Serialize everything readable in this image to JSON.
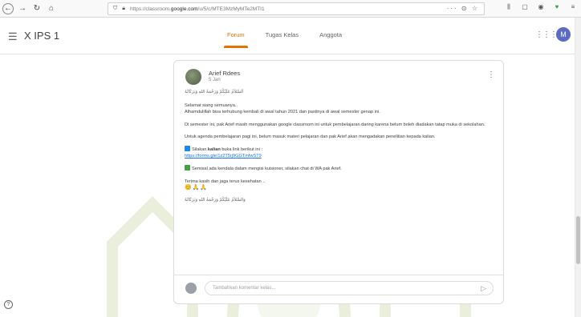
{
  "browser": {
    "url_prefix": "https://classroom.",
    "url_domain": "google.com",
    "url_path": "/u/5/c/MTE3MzMyMTe2MTI1",
    "url_actions": "··· ⊙ ☆"
  },
  "header": {
    "class_title": "X IPS 1",
    "tabs": [
      {
        "label": "Forum"
      },
      {
        "label": "Tugas Kelas"
      },
      {
        "label": "Anggota"
      }
    ],
    "avatar_initial": "M"
  },
  "post": {
    "author": "Arief Rdees",
    "date": "5 Jan",
    "arabic_greeting": "اَلسَّلاَمُ عَلَيْكُمْ وَرَحْمَةُ اللهِ وَبَرَكَاتُهُ",
    "line1": "Selamat siang semuanya..",
    "line2": "Alhamdulillah bisa terhubung kembali di awal tahun 2021 dan pastinya di awal semester genap ini.",
    "para2": "Di semester ini, pak Arief masih menggunakan google classroom ini untuk pembelajaran daring karena belum boleh diadakan tatap muka di sekolahan.",
    "para3": "Untuk agenda pembelajaran pagi ini, belum masuk materi pelajaran dan pak Arief akan mengadakan penelitian kepada kalian.",
    "instruction_prefix": "Silakan ",
    "instruction_bold": "kalian",
    "instruction_suffix": " buka link berikut ini :",
    "link": "https://forms.gle/1z2T5rj9GGTmfwST9",
    "contact_note": "Semisal ada kendala dalam mengisi kuisioner, silakan chat di WA pak Arief.",
    "closing": "Terima kasih dan jaga terus kesehatan ..",
    "closing_emojis": "😊🙏🙏",
    "arabic_closing": "وَالسَّلاَمُ عَلَيْكُمْ وَرَحْمَةُ اللهِ وَبَرَكَاتُهُ"
  },
  "comment": {
    "placeholder": "Tambahkan komentar kelas..."
  }
}
